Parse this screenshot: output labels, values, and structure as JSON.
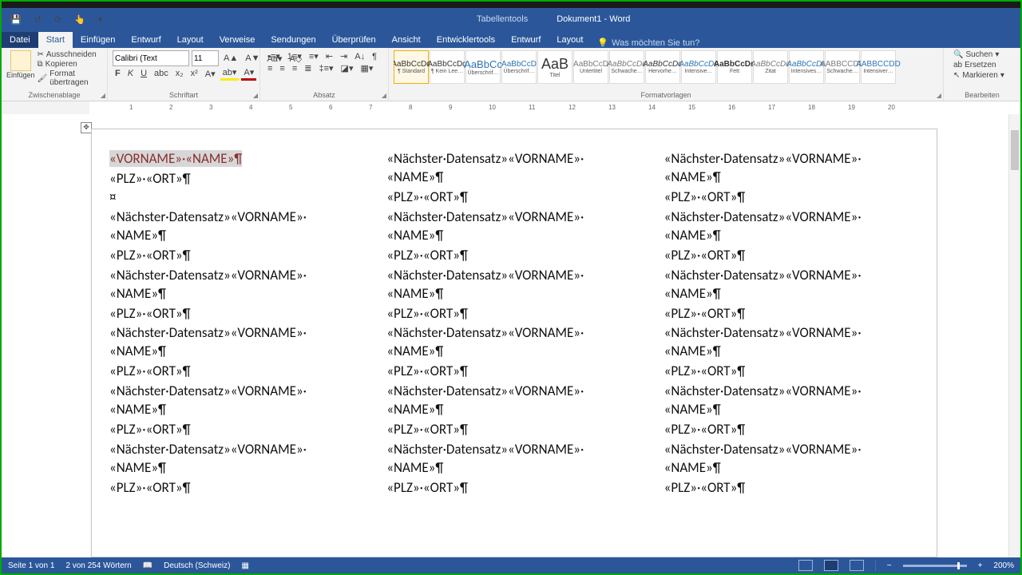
{
  "titlebar": {
    "tool_context": "Tabellentools",
    "doc_title": "Dokument1 - Word"
  },
  "qat": {
    "save": "💾",
    "undo": "↺",
    "redo": "↻",
    "repeat": "⟳",
    "touch": "👆",
    "more": "▾"
  },
  "tabs": {
    "file": "Datei",
    "items": [
      "Start",
      "Einfügen",
      "Entwurf",
      "Layout",
      "Verweise",
      "Sendungen",
      "Überprüfen",
      "Ansicht",
      "Entwicklertools",
      "Entwurf",
      "Layout"
    ],
    "active": "Start",
    "tell_icon": "💡",
    "tell": "Was möchten Sie tun?"
  },
  "ribbon": {
    "clipboard": {
      "paste": "Einfügen",
      "cut": "Ausschneiden",
      "copy": "Kopieren",
      "format": "Format übertragen",
      "label": "Zwischenablage"
    },
    "font": {
      "name": "Calibri (Text",
      "size": "11",
      "label": "Schriftart"
    },
    "paragraph": {
      "label": "Absatz"
    },
    "styles": {
      "label": "Formatvorlagen",
      "items": [
        {
          "sample": "AaBbCcDd",
          "name": "¶ Standard"
        },
        {
          "sample": "AaBbCcDd",
          "name": "¶ Kein Lee…"
        },
        {
          "sample": "AaBbCc",
          "name": "Überschrif…",
          "color": "#2e74b5",
          "size": "13"
        },
        {
          "sample": "AaBbCcD",
          "name": "Überschrif…",
          "color": "#2e74b5"
        },
        {
          "sample": "AaB",
          "name": "Titel",
          "size": "18"
        },
        {
          "sample": "AaBbCcD",
          "name": "Untertitel",
          "color": "#7b7b7b"
        },
        {
          "sample": "AaBbCcDd",
          "name": "Schwache…",
          "it": true,
          "color": "#7b7b7b"
        },
        {
          "sample": "AaBbCcDd",
          "name": "Hervorhe…",
          "it": true
        },
        {
          "sample": "AaBbCcDd",
          "name": "Intensive…",
          "it": true,
          "color": "#2e74b5"
        },
        {
          "sample": "AaBbCcDd",
          "name": "Fett",
          "bold": true
        },
        {
          "sample": "AaBbCcDd",
          "name": "Zitat",
          "it": true,
          "color": "#7b7b7b"
        },
        {
          "sample": "AaBbCcDd",
          "name": "Intensives…",
          "it": true,
          "color": "#2e74b5"
        },
        {
          "sample": "AaBbCcDd",
          "name": "Schwache…",
          "caps": true,
          "color": "#7b7b7b"
        },
        {
          "sample": "AaBbCcDd",
          "name": "Intensiver…",
          "caps": true,
          "color": "#2e74b5"
        }
      ]
    },
    "editing": {
      "find": "Suchen",
      "replace": "Ersetzen",
      "select": "Markieren",
      "label": "Bearbeiten"
    }
  },
  "ruler": {
    "ticks_cm": [
      1,
      2,
      3,
      4,
      5,
      6,
      7,
      8,
      9,
      10,
      11,
      12,
      13,
      14,
      15,
      16,
      17,
      18,
      19,
      20
    ]
  },
  "document": {
    "fields": {
      "first_line1": "«VORNAME»·«NAME»¶",
      "next_line1": "«Nächster·Datensatz»«VORNAME»·",
      "line2": "«NAME»¶",
      "plz": "«PLZ»·«ORT»¶",
      "endcell": "¤"
    },
    "rows": 6,
    "cols": 3
  },
  "status": {
    "page": "Seite 1 von 1",
    "words": "2 von 254 Wörtern",
    "lang": "Deutsch (Schweiz)",
    "zoom": "200%"
  }
}
